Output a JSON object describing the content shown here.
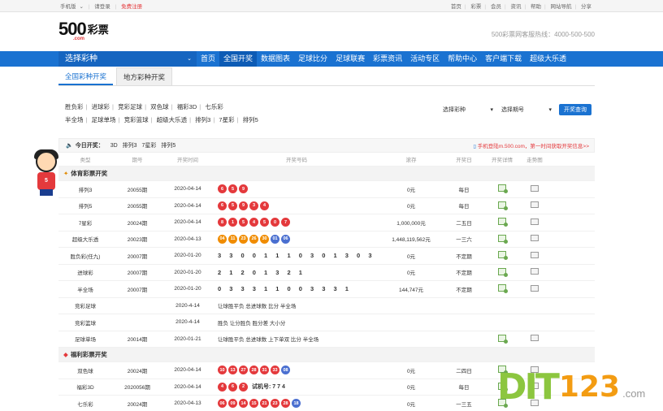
{
  "topbar": {
    "left": [
      "手机版",
      "请登录",
      "免费注册"
    ],
    "right": [
      "首页",
      "彩票",
      "会员",
      "资讯",
      "帮助",
      "网站导航",
      "分享"
    ]
  },
  "logo": {
    "num": "500",
    "com": ".com",
    "txt": "彩票"
  },
  "hotline": "500彩票网客服热线：4000-500-500",
  "nav": {
    "choose": "选择彩种",
    "items": [
      "首页",
      "全国开奖",
      "数据图表",
      "足球比分",
      "足球联赛",
      "彩票资讯",
      "活动专区",
      "帮助中心",
      "客户端下载",
      "超级大乐透"
    ]
  },
  "tabs": [
    "全国彩种开奖",
    "地方彩种开奖"
  ],
  "lotlinks": {
    "line1": [
      "胜负彩",
      "进球彩",
      "竞彩足球",
      "双色球",
      "福彩3D",
      "七乐彩"
    ],
    "line2": [
      "半全场",
      "足球单场",
      "竞彩篮球",
      "超级大乐透",
      "排列3",
      "7星彩",
      "排列5"
    ]
  },
  "filters": {
    "kind": "选择彩种",
    "issue": "选择期号",
    "button": "开奖查询"
  },
  "today": {
    "title": "今日开奖：",
    "items": [
      "3D",
      "排列3",
      "7星彩",
      "排列5"
    ],
    "promo_prefix": "手机登陆m.500.com，",
    "promo": "第一时间获取开奖信息>>"
  },
  "headers": [
    "类型",
    "期号",
    "开奖时间",
    "开奖号码",
    "滚存",
    "开奖日",
    "开奖详情",
    "走势图"
  ],
  "sections": {
    "sports": "体育彩票开奖",
    "welfare": "福利彩票开奖"
  },
  "sports_rows": [
    {
      "name": "排列3",
      "issue": "20055期",
      "date": "2020-04-14",
      "balls": [
        "6",
        "5",
        "9"
      ],
      "pool": "0元",
      "day": "每日"
    },
    {
      "name": "排列5",
      "issue": "20055期",
      "date": "2020-04-14",
      "balls": [
        "6",
        "5",
        "9",
        "3",
        "4"
      ],
      "pool": "0元",
      "day": "每日"
    },
    {
      "name": "7星彩",
      "issue": "20024期",
      "date": "2020-04-14",
      "balls": [
        "8",
        "1",
        "5",
        "4",
        "5",
        "0",
        "7"
      ],
      "pool": "1,000,000元",
      "day": "二五日"
    },
    {
      "name": "超级大乐透",
      "issue": "20023期",
      "date": "2020-04-13",
      "balls": [
        "04",
        "11",
        "23",
        "26",
        "30",
        "01",
        "06"
      ],
      "pool": "1,448,119,562元",
      "day": "一三六"
    },
    {
      "name": "胜负彩(任九)",
      "issue": "20007期",
      "date": "2020-01-20",
      "digits": "3 3 0 0 1 1 1 0 3 0 1 3 0 3",
      "pool": "0元",
      "day": "不定期"
    },
    {
      "name": "进球彩",
      "issue": "20007期",
      "date": "2020-01-20",
      "digits": "2 1 2 0 1 3 2 1",
      "pool": "0元",
      "day": "不定期"
    },
    {
      "name": "半全场",
      "issue": "20007期",
      "date": "2020-01-20",
      "digits": "0 3 3 3 1 1 0 0 3 3 3 1",
      "pool": "144,747元",
      "day": "不定期"
    },
    {
      "name": "竞彩足球",
      "issue": "",
      "date": "2020-4-14",
      "text": "让球胜平负 总进球数 比分 半全场",
      "pool": "",
      "day": ""
    },
    {
      "name": "竞彩篮球",
      "issue": "",
      "date": "2020-4-14",
      "text": "胜负 让分胜负 胜分差 大小分",
      "pool": "",
      "day": ""
    },
    {
      "name": "足球单场",
      "issue": "20014期",
      "date": "2020-01-21",
      "text": "让球胜平负 总进球数 上下单双 比分 半全场",
      "pool": "",
      "day": ""
    }
  ],
  "welfare_rows": [
    {
      "name": "双色球",
      "issue": "20024期",
      "date": "2020-04-14",
      "balls": [
        "10",
        "13",
        "27",
        "28",
        "31",
        "33",
        "08"
      ],
      "pool": "0元",
      "day": "二四日"
    },
    {
      "name": "福彩3D",
      "issue": "2020056期",
      "date": "2020-04-14",
      "balls": [
        "4",
        "6",
        "2"
      ],
      "test": "试机号: 7 7 4",
      "pool": "0元",
      "day": "每日"
    },
    {
      "name": "七乐彩",
      "issue": "20024期",
      "date": "2020-04-13",
      "balls": [
        "06",
        "09",
        "14",
        "15",
        "21",
        "23",
        "28",
        "18"
      ],
      "pool": "0元",
      "day": "一三五"
    }
  ],
  "mascot_label": "5",
  "watermark": {
    "main": "DIT",
    "num": "123",
    "dot": ".com"
  },
  "colors": {
    "nav": "#1a72d1",
    "ball_red": "#e4393c",
    "ball_blue": "#4a6fd0",
    "ball_orange": "#f08c00"
  }
}
